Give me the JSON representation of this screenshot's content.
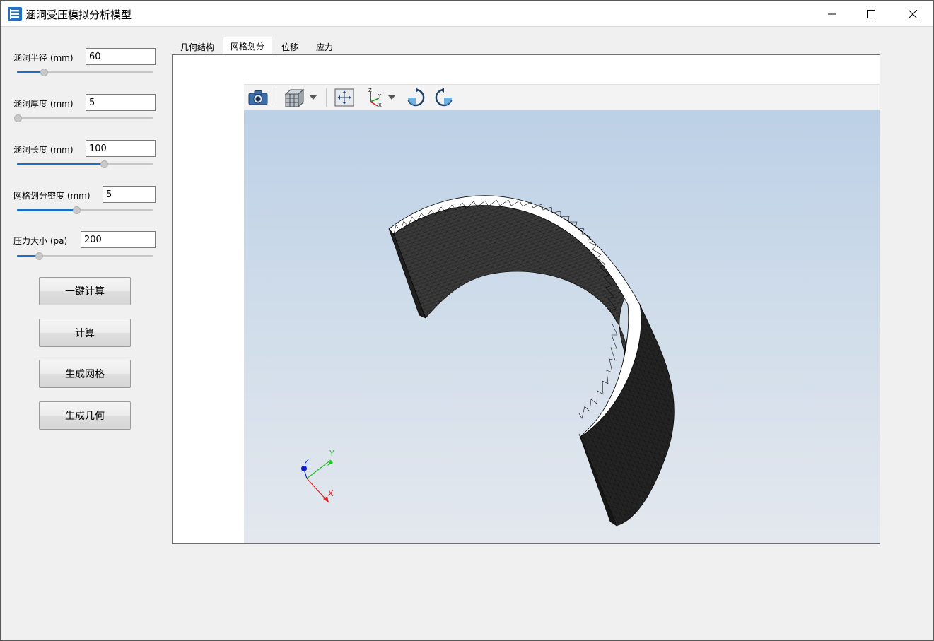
{
  "window": {
    "title": "涵洞受压模拟分析模型"
  },
  "params": [
    {
      "label": "涵洞半径 (mm)",
      "value": "60",
      "slider_fraction": 0.2
    },
    {
      "label": "涵洞厚度 (mm)",
      "value": "5",
      "slider_fraction": 0.0
    },
    {
      "label": "涵洞长度 (mm)",
      "value": "100",
      "slider_fraction": 0.64
    },
    {
      "label": "网格划分密度 (mm)",
      "value": "5",
      "slider_fraction": 0.44
    },
    {
      "label": "压力大小 (pa)",
      "value": "200",
      "slider_fraction": 0.16
    }
  ],
  "buttons": {
    "one_click": "一键计算",
    "compute": "计算",
    "mesh": "生成网格",
    "geometry": "生成几何"
  },
  "tabs": [
    {
      "label": "几何结构"
    },
    {
      "label": "网格划分"
    },
    {
      "label": "位移"
    },
    {
      "label": "应力"
    }
  ],
  "active_tab": "网格划分",
  "axes": {
    "x": "X",
    "y": "Y",
    "z": "Z"
  },
  "colors": {
    "slider_fill": "#1a6fc9",
    "axis_x": "#e02020",
    "axis_y": "#20c020",
    "axis_z": "#1020c0",
    "mesh_face": "#3a3a3a"
  },
  "icons": [
    "app-icon",
    "minimize-icon",
    "maximize-icon",
    "close-icon",
    "camera-icon",
    "view-cube-icon",
    "dropdown-icon",
    "fit-view-icon",
    "axes-orientation-icon",
    "rotate-cw-icon",
    "rotate-ccw-icon"
  ]
}
